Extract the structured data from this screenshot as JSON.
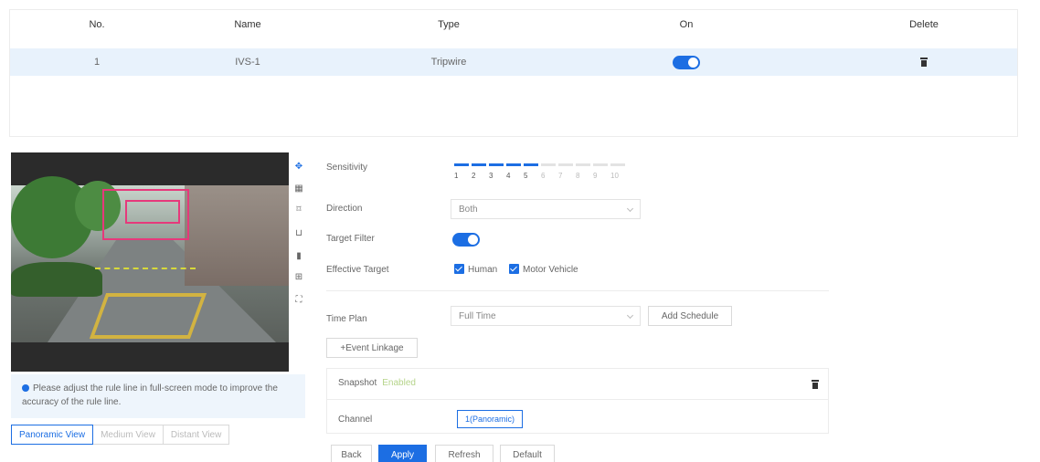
{
  "table": {
    "headers": {
      "no": "No.",
      "name": "Name",
      "type": "Type",
      "on": "On",
      "delete": "Delete"
    },
    "rows": [
      {
        "no": "1",
        "name": "IVS-1",
        "type": "Tripwire",
        "on": true
      }
    ]
  },
  "preview": {
    "tools": [
      "move-icon",
      "grid-icon",
      "draw-rule-icon",
      "target-size-icon",
      "delete-icon",
      "detect-area-icon",
      "fullscreen-icon"
    ]
  },
  "info": {
    "message": "Please adjust the rule line in full-screen mode to improve the accuracy of the rule line."
  },
  "view_tabs": [
    "Panoramic View",
    "Medium View",
    "Distant View"
  ],
  "form": {
    "sensitivity_label": "Sensitivity",
    "sensitivity_value": 5,
    "sensitivity_max": 10,
    "sensitivity_ticks": [
      "1",
      "2",
      "3",
      "4",
      "5",
      "6",
      "7",
      "8",
      "9",
      "10"
    ],
    "direction_label": "Direction",
    "direction_value": "Both",
    "target_filter_label": "Target Filter",
    "target_filter_on": true,
    "effective_target_label": "Effective Target",
    "effective_targets": [
      {
        "label": "Human",
        "checked": true
      },
      {
        "label": "Motor Vehicle",
        "checked": true
      }
    ],
    "time_plan_label": "Time Plan",
    "time_plan_value": "Full Time",
    "add_schedule_label": "Add Schedule",
    "event_linkage_label": "+Event Linkage",
    "snapshot_label": "Snapshot",
    "snapshot_status": "Enabled",
    "channel_label": "Channel",
    "channel_value": "1(Panoramic)"
  },
  "footer": {
    "back": "Back",
    "apply": "Apply",
    "refresh": "Refresh",
    "default": "Default"
  },
  "colors": {
    "accent": "#1c6ee3",
    "row_highlight": "#e8f2fc",
    "rule_box": "#e6397b"
  }
}
